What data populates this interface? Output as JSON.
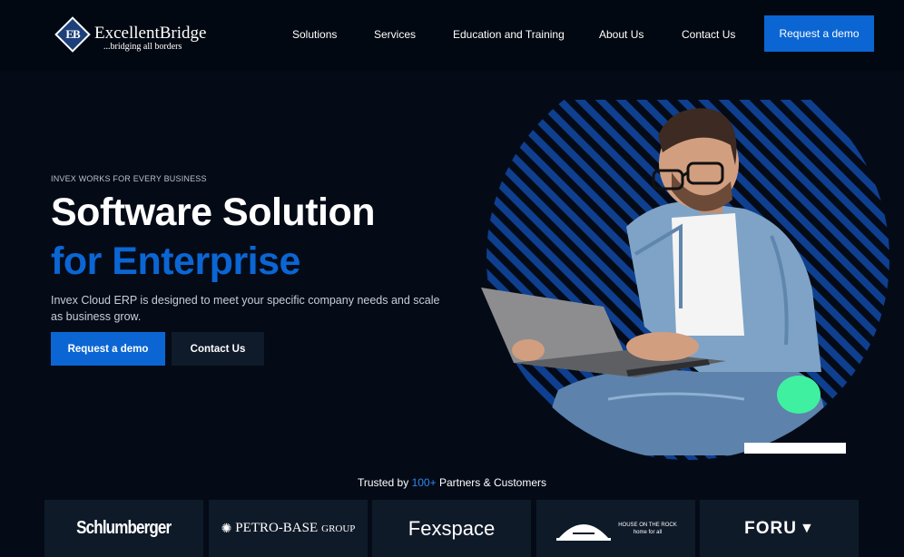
{
  "header": {
    "logo": {
      "mark_letters": "EB",
      "name": "ExcellentBridge",
      "tagline": "...bridging all borders"
    },
    "nav": [
      {
        "label": "Solutions"
      },
      {
        "label": "Services"
      },
      {
        "label": "Education and Training"
      },
      {
        "label": "About Us"
      },
      {
        "label": "Contact Us"
      }
    ],
    "cta_label": "Request a demo"
  },
  "hero": {
    "eyebrow": "INVEX WORKS FOR EVERY BUSINESS",
    "title": "Software Solution",
    "title_accent": "for Enterprise",
    "description": "Invex Cloud ERP is designed to meet your specific company needs and scale as business grow.",
    "primary_button": "Request a demo",
    "secondary_button": "Contact Us"
  },
  "trusted": {
    "prefix": "Trusted by",
    "count": "100+",
    "suffix": "Partners & Customers"
  },
  "partners": [
    {
      "name": "Schlumberger"
    },
    {
      "name": "PETRO-BASE",
      "suffix": "GROUP"
    },
    {
      "name": "Fexspace"
    },
    {
      "name": "HOUSE ON THE ROCK",
      "tagline": "home for all"
    },
    {
      "name": "FORU"
    }
  ],
  "colors": {
    "background": "#040b17",
    "accent": "#0b66d4",
    "card": "#0f1a29",
    "highlight_green": "#3ef0a0"
  }
}
